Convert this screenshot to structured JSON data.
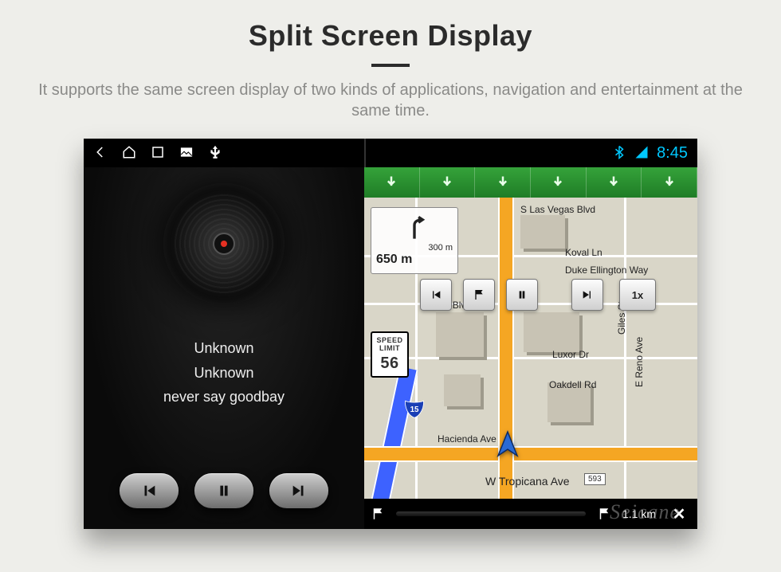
{
  "page": {
    "title": "Split Screen Display",
    "description": "It supports the same screen display of two kinds of applications, navigation and entertainment at the same time."
  },
  "statusbar": {
    "clock": "8:45"
  },
  "player": {
    "title": "Unknown",
    "artist": "Unknown",
    "track": "never say goodbay"
  },
  "nav": {
    "turn_hint_dist1": "300 m",
    "turn_hint_dist2": "650 m",
    "speed_btn": "1x",
    "speed_limit_label": "SPEED LIMIT",
    "speed_limit_value": "56",
    "streets": {
      "s_las_vegas": "S Las Vegas Blvd",
      "koval": "Koval Ln",
      "duke_ellington": "Duke Ellington Way",
      "las_vegas_blvd": "Vegas Blvd",
      "luxor": "Luxor Dr",
      "reno": "E Reno Ave",
      "hacienda": "Hacienda Ave",
      "oakdell": "Oakdell Rd",
      "tropicana": "W Tropicana Ave",
      "giles": "Giles St",
      "tropicana_num": "593"
    },
    "hwy_shield": "15",
    "bottom_dist": "1.1 km"
  },
  "watermark": "Seicane"
}
